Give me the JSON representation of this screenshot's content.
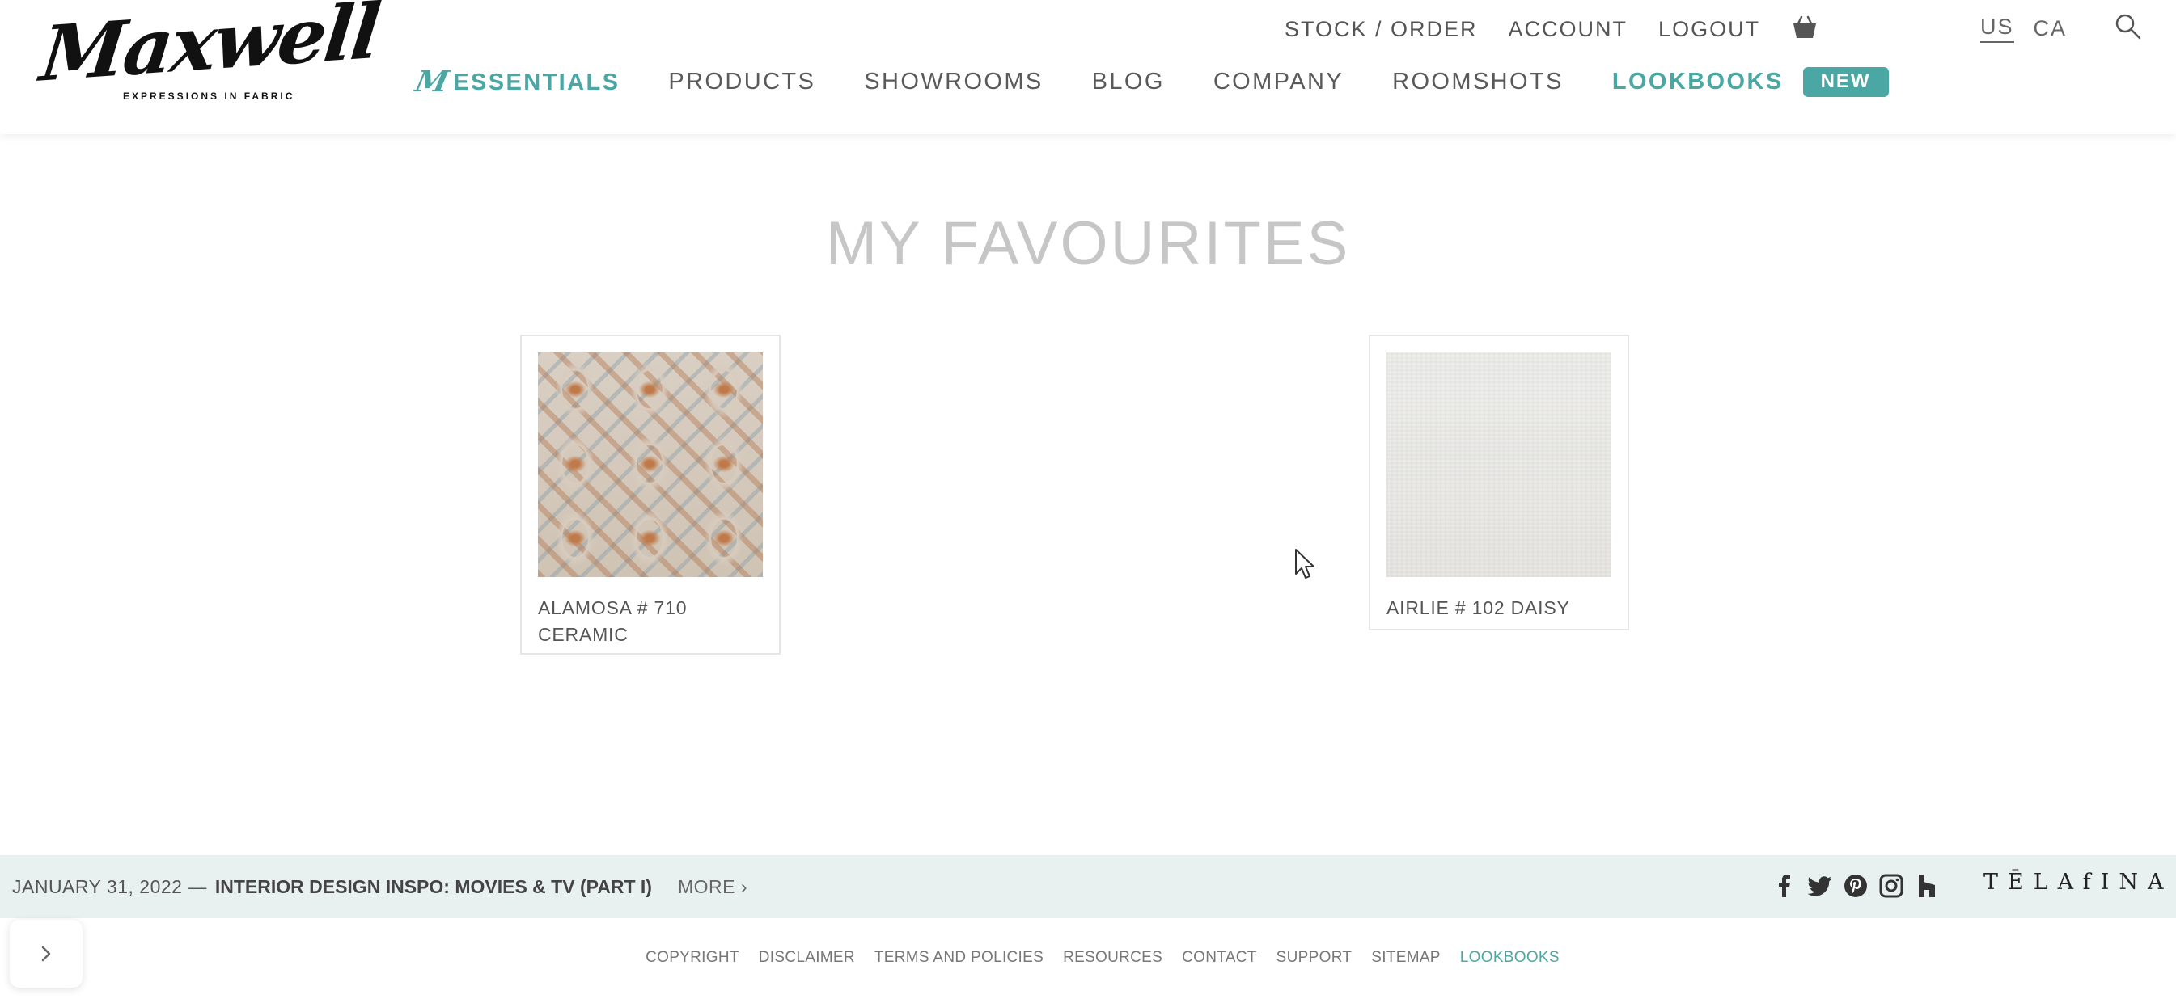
{
  "brand": {
    "name": "Maxwell",
    "tagline": "EXPRESSIONS IN FABRIC"
  },
  "utility_nav": [
    {
      "label": "STOCK / ORDER"
    },
    {
      "label": "ACCOUNT"
    },
    {
      "label": "LOGOUT"
    }
  ],
  "cart": {
    "icon": "basket-icon"
  },
  "language": {
    "options": [
      "US",
      "CA"
    ],
    "selected": "US"
  },
  "search": {
    "icon": "search-icon"
  },
  "main_nav": [
    {
      "label": "ESSENTIALS",
      "accent": true,
      "icon": "maxwell-m-icon"
    },
    {
      "label": "PRODUCTS"
    },
    {
      "label": "SHOWROOMS"
    },
    {
      "label": "BLOG"
    },
    {
      "label": "COMPANY"
    },
    {
      "label": "ROOMSHOTS"
    },
    {
      "label": "LOOKBOOKS",
      "accent": true
    },
    {
      "label": "NEW",
      "badge": true
    }
  ],
  "colors": {
    "accent": "#4aa7a3",
    "title": "#c6c6c6",
    "news_bar": "#e8f0f0"
  },
  "page": {
    "title": "MY FAVOURITES"
  },
  "favourites": [
    {
      "name": "ALAMOSA # 710 CERAMIC",
      "swatch": "ikat-ceramic"
    },
    {
      "name": "AIRLIE # 102 DAISY",
      "swatch": "linen-daisy"
    }
  ],
  "news": {
    "date": "JANUARY 31, 2022 —",
    "title": "INTERIOR DESIGN INSPO: MOVIES & TV (PART I)",
    "more": "MORE ›"
  },
  "social": [
    "facebook-icon",
    "twitter-icon",
    "pinterest-icon",
    "instagram-icon",
    "houzz-icon"
  ],
  "partner_logo": "TĒLAfINA",
  "footer_links": [
    {
      "label": "COPYRIGHT"
    },
    {
      "label": "DISCLAIMER"
    },
    {
      "label": "TERMS AND POLICIES"
    },
    {
      "label": "RESOURCES"
    },
    {
      "label": "CONTACT"
    },
    {
      "label": "SUPPORT"
    },
    {
      "label": "SITEMAP"
    },
    {
      "label": "LOOKBOOKS",
      "accent": true
    }
  ],
  "side_toggle": {
    "icon": "chevron-right-icon"
  }
}
